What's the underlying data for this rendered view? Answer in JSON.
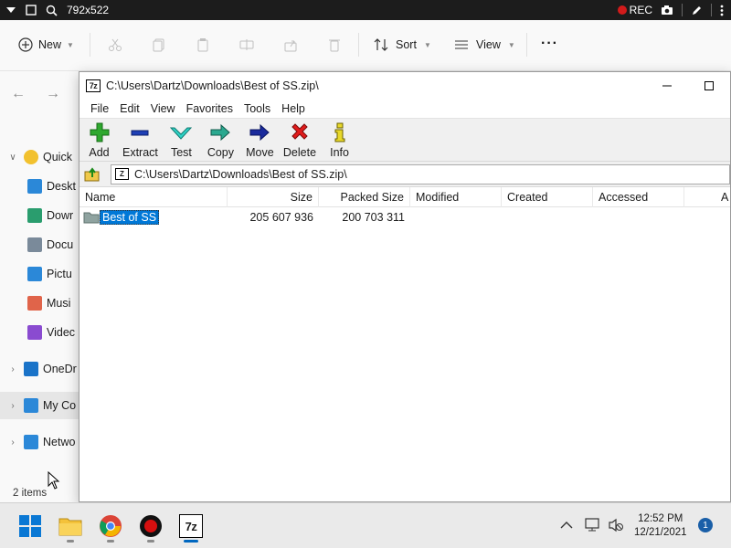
{
  "recbar": {
    "resolution": "792x522",
    "rec_label": "REC"
  },
  "explorer": {
    "toolbar": {
      "new_label": "New",
      "sort_label": "Sort",
      "view_label": "View",
      "more_label": "···"
    },
    "nav": [
      {
        "label": "Quick",
        "icon": "star-icon",
        "color": "#f2c12e"
      },
      {
        "label": "Deskt",
        "icon": "desktop-icon",
        "color": "#2b88d8"
      },
      {
        "label": "Dowr",
        "icon": "download-icon",
        "color": "#2a9d6e"
      },
      {
        "label": "Docu",
        "icon": "document-icon",
        "color": "#7a8a9a"
      },
      {
        "label": "Pictu",
        "icon": "pictures-icon",
        "color": "#2b88d8"
      },
      {
        "label": "Musi",
        "icon": "music-icon",
        "color": "#e0644a"
      },
      {
        "label": "Videc",
        "icon": "videos-icon",
        "color": "#8a4bd0"
      },
      {
        "label": "OneDr",
        "icon": "onedrive-icon",
        "color": "#1a73c8"
      },
      {
        "label": "My Co",
        "icon": "computer-icon",
        "color": "#2b88d8"
      },
      {
        "label": "Netwo",
        "icon": "network-icon",
        "color": "#2b88d8"
      }
    ],
    "status": "2 items"
  },
  "zip": {
    "title": "C:\\Users\\Dartz\\Downloads\\Best of SS.zip\\",
    "menu": [
      "File",
      "Edit",
      "View",
      "Favorites",
      "Tools",
      "Help"
    ],
    "tools": [
      "Add",
      "Extract",
      "Test",
      "Copy",
      "Move",
      "Delete",
      "Info"
    ],
    "address": "C:\\Users\\Dartz\\Downloads\\Best of SS.zip\\",
    "columns": [
      "Name",
      "Size",
      "Packed Size",
      "Modified",
      "Created",
      "Accessed",
      "A"
    ],
    "rows": [
      {
        "name": "Best of SS",
        "size": "205 607 936",
        "packed": "200 703 311"
      }
    ]
  },
  "taskbar": {
    "time": "12:52 PM",
    "date": "12/21/2021",
    "notifications": "1"
  }
}
